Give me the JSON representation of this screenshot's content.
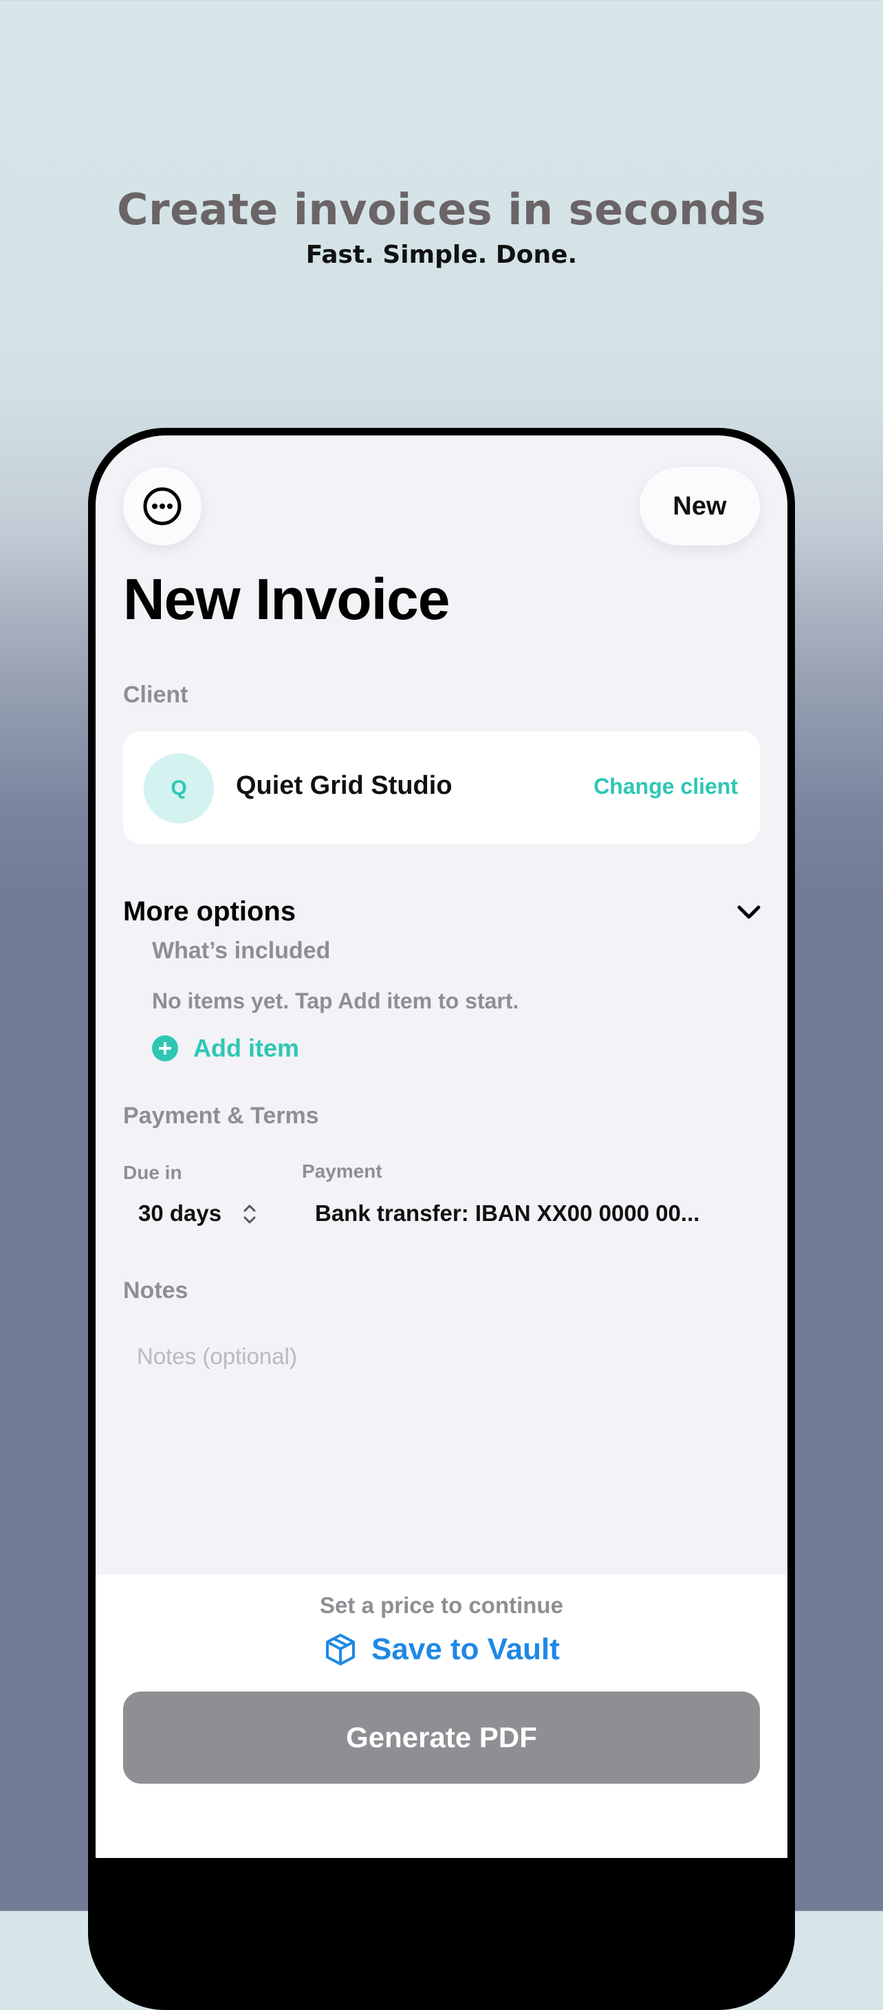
{
  "marketing": {
    "headline": "Create invoices in seconds",
    "subline": "Fast. Simple. Done."
  },
  "header": {
    "new_label": "New",
    "title": "New Invoice"
  },
  "client": {
    "section_label": "Client",
    "avatar_letter": "Q",
    "name": "Quiet Grid Studio",
    "change_label": "Change client"
  },
  "options": {
    "title": "More options",
    "included_label": "What’s included",
    "empty_text": "No items yet. Tap Add item to start.",
    "add_item_label": "Add item"
  },
  "payment_terms": {
    "section_label": "Payment & Terms",
    "due_label": "Due in",
    "due_value": "30 days",
    "payment_label": "Payment",
    "payment_value": "Bank transfer: IBAN XX00 0000 00..."
  },
  "notes": {
    "section_label": "Notes",
    "placeholder": "Notes (optional)"
  },
  "footer": {
    "price_hint": "Set a price to continue",
    "vault_label": "Save to Vault",
    "generate_label": "Generate PDF"
  },
  "colors": {
    "accent": "#2ec7b4",
    "vault_blue": "#1f88e5",
    "disabled_button": "#8e8e93"
  },
  "icons": {
    "menu": "ellipsis-circle-icon",
    "collapse": "chevron-down-icon",
    "add": "plus-circle-icon",
    "stepper": "chevron-up-down-icon",
    "vault": "cube-icon"
  }
}
